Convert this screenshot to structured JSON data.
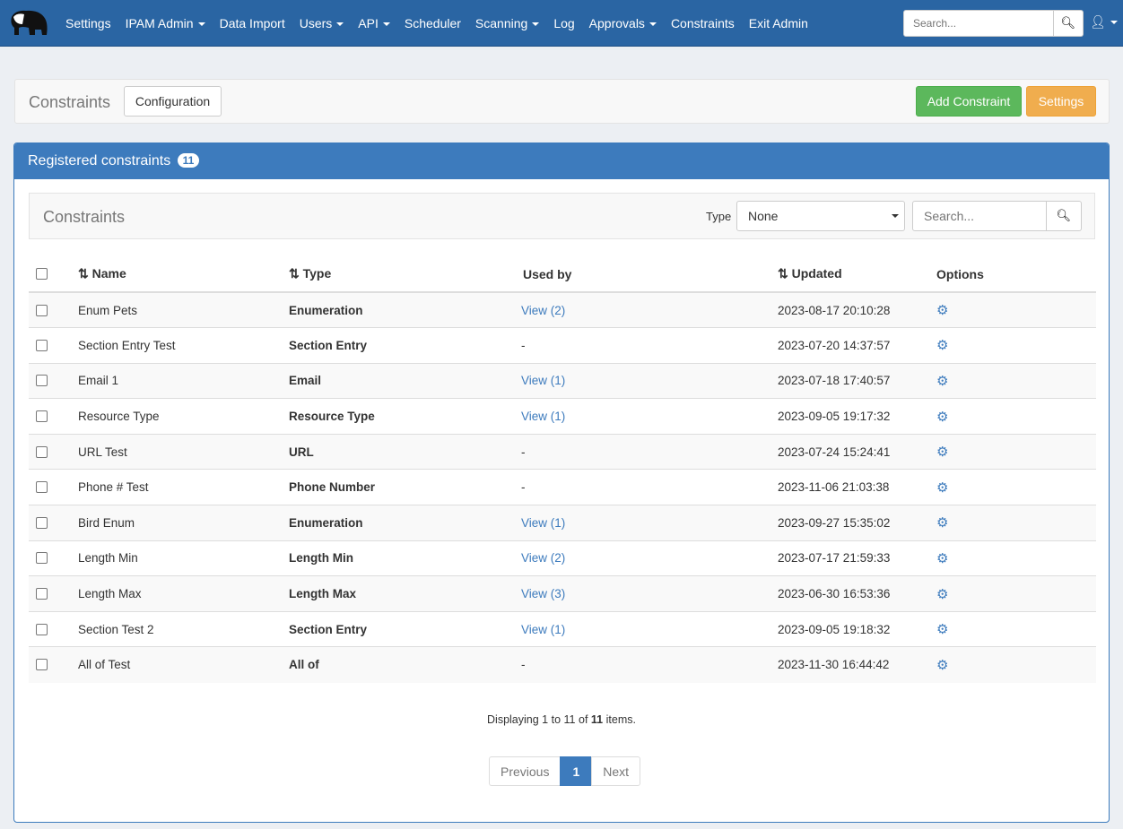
{
  "nav": {
    "items": [
      {
        "label": "Settings",
        "caret": false
      },
      {
        "label": "IPAM Admin",
        "caret": true
      },
      {
        "label": "Data Import",
        "caret": false
      },
      {
        "label": "Users",
        "caret": true
      },
      {
        "label": "API",
        "caret": true
      },
      {
        "label": "Scheduler",
        "caret": false
      },
      {
        "label": "Scanning",
        "caret": true
      },
      {
        "label": "Log",
        "caret": false
      },
      {
        "label": "Approvals",
        "caret": true
      },
      {
        "label": "Constraints",
        "caret": false
      },
      {
        "label": "Exit Admin",
        "caret": false
      }
    ],
    "search_placeholder": "Search..."
  },
  "top": {
    "title": "Constraints",
    "configuration": "Configuration",
    "add": "Add Constraint",
    "settings": "Settings",
    "add_color": "#5cb85c",
    "settings_color": "#f0ad4e"
  },
  "panel": {
    "title": "Registered constraints",
    "count": "11",
    "toolbar_title": "Constraints",
    "type_label": "Type",
    "type_value": "None",
    "search_placeholder": "Search..."
  },
  "table": {
    "headers": [
      "Name",
      "Type",
      "Used by",
      "Updated",
      "Options"
    ],
    "rows": [
      [
        "Enum Pets",
        "Enumeration",
        "View (2)",
        "2023-08-17 20:10:28"
      ],
      [
        "Section Entry Test",
        "Section Entry",
        "-",
        "2023-07-20 14:37:57"
      ],
      [
        "Email 1",
        "Email",
        "View (1)",
        "2023-07-18 17:40:57"
      ],
      [
        "Resource Type",
        "Resource Type",
        "View (1)",
        "2023-09-05 19:17:32"
      ],
      [
        "URL Test",
        "URL",
        "-",
        "2023-07-24 15:24:41"
      ],
      [
        "Phone # Test",
        "Phone Number",
        "-",
        "2023-11-06 21:03:38"
      ],
      [
        "Bird Enum",
        "Enumeration",
        "View (1)",
        "2023-09-27 15:35:02"
      ],
      [
        "Length Min",
        "Length Min",
        "View (2)",
        "2023-07-17 21:59:33"
      ],
      [
        "Length Max",
        "Length Max",
        "View (3)",
        "2023-06-30 16:53:36"
      ],
      [
        "Section Test 2",
        "Section Entry",
        "View (1)",
        "2023-09-05 19:18:32"
      ],
      [
        "All of Test",
        "All of",
        "-",
        "2023-11-30 16:44:42"
      ]
    ]
  },
  "footer": {
    "displaying": "Displaying",
    "from": "1",
    "to_word": "to",
    "to": "11",
    "of_word": "of",
    "total": "11",
    "items": "items.",
    "previous": "Previous",
    "page": "1",
    "next": "Next"
  }
}
